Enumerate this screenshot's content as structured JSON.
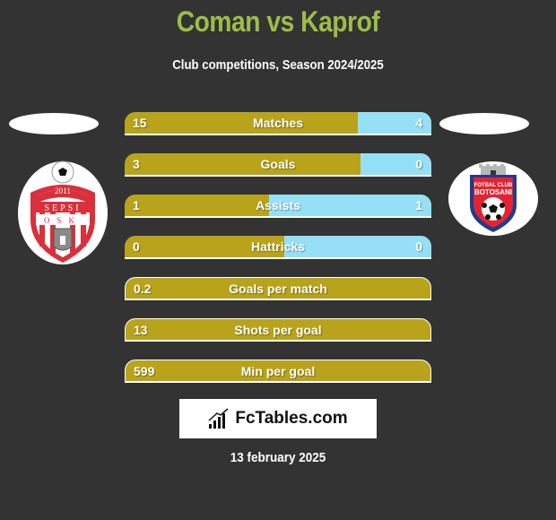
{
  "header": {
    "title": "Coman vs Kaprof",
    "subtitle": "Club competitions, Season 2024/2025"
  },
  "teams": {
    "left": {
      "name": "Sepsi OSK",
      "crest_year": "2011",
      "crest_text_top": "SEPSI",
      "crest_text_bottom": "OSK"
    },
    "right": {
      "name": "FC Botosani",
      "crest_text_top": "FOTBAL CLUB",
      "crest_text_bottom": "BOTOSANI"
    }
  },
  "colors": {
    "title": "#9dbd47",
    "left_bar": "#b8a31b",
    "right_bar": "#95e0f7",
    "background": "#333333"
  },
  "stats": [
    {
      "label": "Matches",
      "left": "15",
      "right": "4",
      "left_share": 0.76
    },
    {
      "label": "Goals",
      "left": "3",
      "right": "0",
      "left_share": 0.77
    },
    {
      "label": "Assists",
      "left": "1",
      "right": "1",
      "left_share": 0.47
    },
    {
      "label": "Hattricks",
      "left": "0",
      "right": "0",
      "left_share": 0.52
    },
    {
      "label": "Goals per match",
      "left": "0.2",
      "right": null,
      "left_share": 1
    },
    {
      "label": "Shots per goal",
      "left": "13",
      "right": null,
      "left_share": 1
    },
    {
      "label": "Min per goal",
      "left": "599",
      "right": null,
      "left_share": 1
    }
  ],
  "brand": {
    "icon": "bar-chart-icon",
    "text": "FcTables.com"
  },
  "date": "13 february 2025"
}
